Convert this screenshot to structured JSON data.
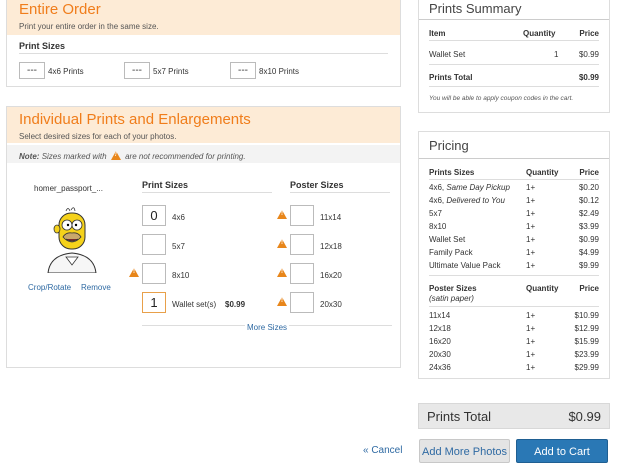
{
  "entire_order": {
    "title": "Entire Order",
    "subtitle": "Print your entire order in the same size.",
    "print_sizes_label": "Print Sizes",
    "sizes": [
      {
        "value": "---",
        "label": "4x6 Prints"
      },
      {
        "value": "---",
        "label": "5x7 Prints"
      },
      {
        "value": "---",
        "label": "8x10 Prints"
      }
    ]
  },
  "individual": {
    "title": "Individual Prints and Enlargements",
    "subtitle": "Select desired sizes for each of your photos.",
    "note_bold": "Note:",
    "note_text_1": "Sizes marked with",
    "note_text_2": "are not recommended for printing.",
    "photo_name": "homer_passport_...",
    "crop_rotate": "Crop/Rotate",
    "remove": "Remove",
    "print_sizes_header": "Print Sizes",
    "poster_sizes_header": "Poster Sizes",
    "print_sizes": [
      {
        "value": "0",
        "label": "4x6",
        "warn": false
      },
      {
        "value": "",
        "label": "5x7",
        "warn": false
      },
      {
        "value": "",
        "label": "8x10",
        "warn": true
      },
      {
        "value": "1",
        "label": "Wallet set(s)",
        "warn": false,
        "price": "$0.99"
      }
    ],
    "poster_sizes": [
      {
        "value": "",
        "label": "11x14",
        "warn": true
      },
      {
        "value": "",
        "label": "12x18",
        "warn": true
      },
      {
        "value": "",
        "label": "16x20",
        "warn": true
      },
      {
        "value": "",
        "label": "20x30",
        "warn": true
      }
    ],
    "more_sizes": "More Sizes",
    "warn_glyph": "!"
  },
  "summary": {
    "title": "Prints Summary",
    "col_item": "Item",
    "col_qty": "Quantity",
    "col_price": "Price",
    "rows": [
      {
        "item": "Wallet Set",
        "qty": "1",
        "price": "$0.99"
      }
    ],
    "total_label": "Prints Total",
    "total_value": "$0.99",
    "coupon_note": "You will be able to apply coupon codes in the cart."
  },
  "pricing": {
    "title": "Pricing",
    "col_sizes": "Prints Sizes",
    "col_qty": "Quantity",
    "col_price": "Price",
    "rows": [
      {
        "size": "4x6, ",
        "em": "Same Day Pickup",
        "qty": "1+",
        "price": "$0.20"
      },
      {
        "size": "4x6, ",
        "em": "Delivered to You",
        "qty": "1+",
        "price": "$0.12"
      },
      {
        "size": "5x7",
        "em": "",
        "qty": "1+",
        "price": "$2.49"
      },
      {
        "size": "8x10",
        "em": "",
        "qty": "1+",
        "price": "$3.99"
      },
      {
        "size": "Wallet Set",
        "em": "",
        "qty": "1+",
        "price": "$0.99"
      },
      {
        "size": "Family Pack",
        "em": "",
        "qty": "1+",
        "price": "$4.99"
      },
      {
        "size": "Ultimate Value Pack",
        "em": "",
        "qty": "1+",
        "price": "$9.99"
      }
    ],
    "poster_header": "Poster Sizes",
    "poster_sub": "(satin paper)",
    "poster_rows": [
      {
        "size": "11x14",
        "qty": "1+",
        "price": "$10.99"
      },
      {
        "size": "12x18",
        "qty": "1+",
        "price": "$12.99"
      },
      {
        "size": "16x20",
        "qty": "1+",
        "price": "$15.99"
      },
      {
        "size": "20x30",
        "qty": "1+",
        "price": "$23.99"
      },
      {
        "size": "24x36",
        "qty": "1+",
        "price": "$29.99"
      }
    ]
  },
  "footer": {
    "total_label": "Prints Total",
    "total_value": "$0.99",
    "cancel": "« Cancel",
    "add_photos": "Add More Photos",
    "add_to_cart": "Add to Cart"
  },
  "colors": {
    "orange": "#f07d1b",
    "link": "#2f6aa3",
    "cart_button": "#2a78b5"
  }
}
